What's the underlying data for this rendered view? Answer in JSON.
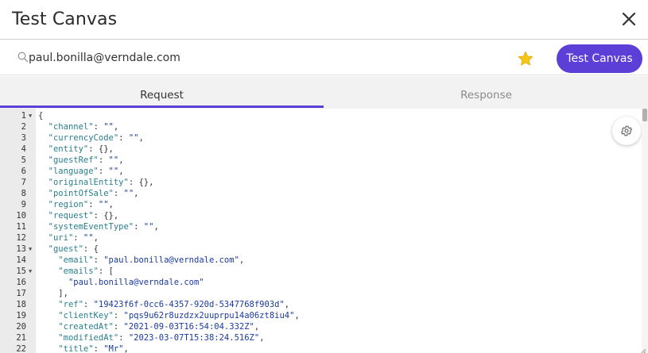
{
  "window": {
    "title": "Test Canvas",
    "close_icon": "close-icon"
  },
  "toolbar": {
    "search_icon": "search-icon",
    "email_value": "paul.bonilla@verndale.com",
    "star_icon": "star-icon",
    "star_color": "#f5c518",
    "test_button_label": "Test Canvas",
    "accent_color": "#5b3fd6"
  },
  "tabs": [
    {
      "label": "Request",
      "active": true
    },
    {
      "label": "Response",
      "active": false
    }
  ],
  "editor": {
    "settings_icon": "gear-icon",
    "lines": [
      {
        "n": "1",
        "fold": true,
        "t": "{"
      },
      {
        "n": "2",
        "t": "  \"channel\": \"\","
      },
      {
        "n": "3",
        "t": "  \"currencyCode\": \"\","
      },
      {
        "n": "4",
        "t": "  \"entity\": {},"
      },
      {
        "n": "5",
        "t": "  \"guestRef\": \"\","
      },
      {
        "n": "6",
        "t": "  \"language\": \"\","
      },
      {
        "n": "7",
        "t": "  \"originalEntity\": {},"
      },
      {
        "n": "8",
        "t": "  \"pointOfSale\": \"\","
      },
      {
        "n": "9",
        "t": "  \"region\": \"\","
      },
      {
        "n": "10",
        "t": "  \"request\": {},"
      },
      {
        "n": "11",
        "t": "  \"systemEventType\": \"\","
      },
      {
        "n": "12",
        "t": "  \"uri\": \"\","
      },
      {
        "n": "13",
        "fold": true,
        "t": "  \"guest\": {"
      },
      {
        "n": "14",
        "t": "    \"email\": \"paul.bonilla@verndale.com\","
      },
      {
        "n": "15",
        "fold": true,
        "t": "    \"emails\": ["
      },
      {
        "n": "16",
        "t": "      \"paul.bonilla@verndale.com\""
      },
      {
        "n": "17",
        "t": "    ],"
      },
      {
        "n": "18",
        "t": "    \"ref\": \"19423f6f-0cc6-4357-920d-5347768f903d\","
      },
      {
        "n": "19",
        "t": "    \"clientKey\": \"pqs9u62r8uzdzx2uuprpu14a06zt8iu4\","
      },
      {
        "n": "20",
        "t": "    \"createdAt\": \"2021-09-03T16:54:04.332Z\","
      },
      {
        "n": "21",
        "t": "    \"modifiedAt\": \"2023-03-07T15:38:24.516Z\","
      },
      {
        "n": "22",
        "t": "    \"title\": \"Mr\","
      }
    ]
  }
}
